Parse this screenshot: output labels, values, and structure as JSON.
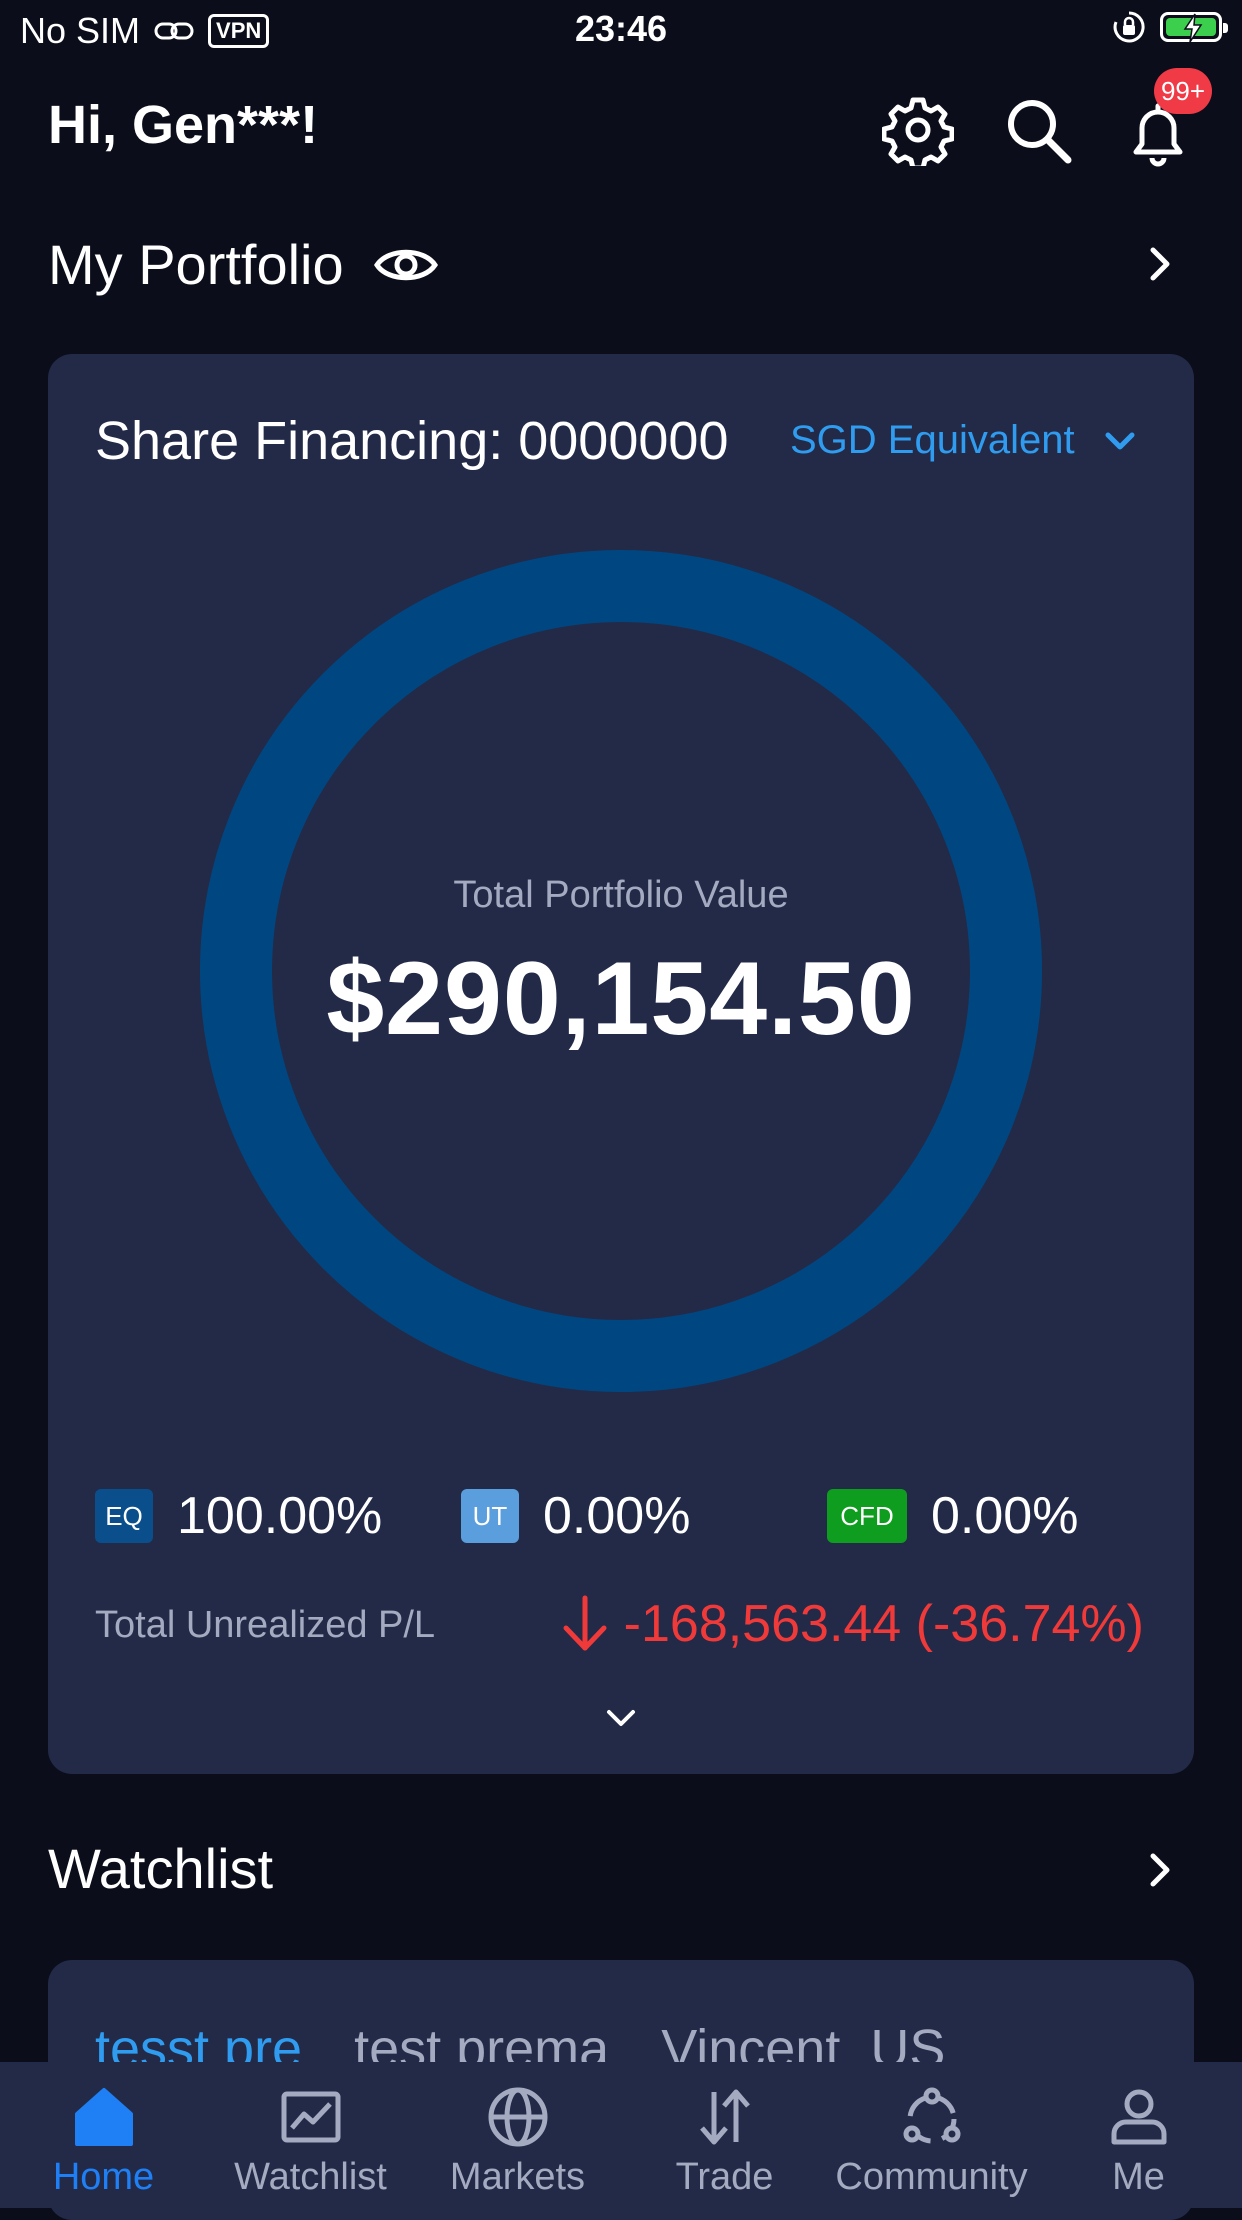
{
  "status_bar": {
    "carrier": "No SIM",
    "vpn": "VPN",
    "time": "23:46"
  },
  "header": {
    "greeting": "Hi, Gen***!",
    "notification_badge": "99+"
  },
  "portfolio": {
    "title": "My Portfolio",
    "account_label": "Share Financing: 0000000",
    "currency_selector": "SGD Equivalent",
    "total_label": "Total Portfolio Value",
    "total_value": "$290,154.50",
    "allocations": [
      {
        "tag": "EQ",
        "percent": "100.00%",
        "fraction": 1.0,
        "color": "#0a4f8c"
      },
      {
        "tag": "UT",
        "percent": "0.00%",
        "fraction": 0.0,
        "color": "#5b9ede"
      },
      {
        "tag": "CFD",
        "percent": "0.00%",
        "fraction": 0.0,
        "color": "#0f9d1f"
      }
    ],
    "unrealized_label": "Total Unrealized P/L",
    "unrealized_value": "-168,563.44 (-36.74%)",
    "unrealized_color": "#f03a3a"
  },
  "watchlist": {
    "title": "Watchlist",
    "tabs": [
      "tesst pre",
      "test prema",
      "Vincent_US"
    ]
  },
  "bottom_nav": {
    "items": [
      {
        "label": "Home",
        "icon": "home-icon",
        "active": true
      },
      {
        "label": "Watchlist",
        "icon": "chart-icon",
        "active": false
      },
      {
        "label": "Markets",
        "icon": "globe-icon",
        "active": false
      },
      {
        "label": "Trade",
        "icon": "trade-arrows-icon",
        "active": false
      },
      {
        "label": "Community",
        "icon": "community-icon",
        "active": false
      },
      {
        "label": "Me",
        "icon": "person-icon",
        "active": false
      }
    ]
  },
  "colors": {
    "background": "#0b0e1a",
    "card": "#222a48",
    "accent": "#2f9cf0",
    "nav_active": "#1f7ff5",
    "negative": "#f03a3a",
    "donut": "#004782"
  }
}
